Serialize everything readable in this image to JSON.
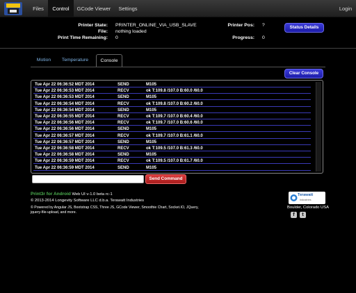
{
  "navbar": {
    "items": [
      {
        "label": "Files"
      },
      {
        "label": "Control",
        "active": true
      },
      {
        "label": "GCode Viewer"
      },
      {
        "label": "Settings"
      }
    ],
    "login": "Login"
  },
  "status": {
    "printer_state_label": "Printer State:",
    "printer_state": "PRINTER_ONLINE_VIA_USB_SLAVE",
    "file_label": "File:",
    "file": "nothing loaded",
    "print_time_label": "Print Time Remaining:",
    "print_time": "0",
    "printer_pos_label": "Printer Pos:",
    "printer_pos": "?",
    "progress_label": "Progress:",
    "progress": "0",
    "details_button": "Status Details"
  },
  "tabs": [
    {
      "label": "Motion"
    },
    {
      "label": "Temperature"
    },
    {
      "label": "Console",
      "active": true
    }
  ],
  "console": {
    "clear_button": "Clear Console",
    "rows": [
      {
        "time": "Tue Apr 22 06:36:52 MDT 2014",
        "dir": "SEND",
        "msg": "M105"
      },
      {
        "time": "Tue Apr 22 06:36:53 MDT 2014",
        "dir": "RECV",
        "msg": "ok T:109.8 /107.0 B:60.0 /60.0"
      },
      {
        "time": "Tue Apr 22 06:36:53 MDT 2014",
        "dir": "SEND",
        "msg": "M105"
      },
      {
        "time": "Tue Apr 22 06:36:54 MDT 2014",
        "dir": "RECV",
        "msg": "ok T:109.8 /107.0 B:60.2 /60.0"
      },
      {
        "time": "Tue Apr 22 06:36:54 MDT 2014",
        "dir": "SEND",
        "msg": "M105"
      },
      {
        "time": "Tue Apr 22 06:36:55 MDT 2014",
        "dir": "RECV",
        "msg": "ok T:109.7 /107.0 B:60.4 /60.0"
      },
      {
        "time": "Tue Apr 22 06:36:56 MDT 2014",
        "dir": "RECV",
        "msg": "ok T:109.7 /107.0 B:60.6 /60.0"
      },
      {
        "time": "Tue Apr 22 06:36:56 MDT 2014",
        "dir": "SEND",
        "msg": "M105"
      },
      {
        "time": "Tue Apr 22 06:36:57 MDT 2014",
        "dir": "RECV",
        "msg": "ok T:109.7 /107.0 B:61.1 /60.0"
      },
      {
        "time": "Tue Apr 22 06:36:57 MDT 2014",
        "dir": "SEND",
        "msg": "M105"
      },
      {
        "time": "Tue Apr 22 06:36:58 MDT 2014",
        "dir": "RECV",
        "msg": "ok T:109.5 /107.0 B:61.3 /60.0"
      },
      {
        "time": "Tue Apr 22 06:36:58 MDT 2014",
        "dir": "SEND",
        "msg": "M105"
      },
      {
        "time": "Tue Apr 22 06:36:59 MDT 2014",
        "dir": "RECV",
        "msg": "ok T:109.5 /107.0 B:61.7 /60.0"
      },
      {
        "time": "Tue Apr 22 06:36:59 MDT 2014",
        "dir": "SEND",
        "msg": "M105"
      }
    ]
  },
  "command": {
    "input_value": "",
    "send_button": "Send Command"
  },
  "footer": {
    "brand": "Print3r for Android",
    "version": "Web UI v-1.0 beta rc-1",
    "copyright": "© 2013-2014 Longevity Software LLC d.b.a. Terawatt Industries",
    "powered_line1": "© Powered by Angular JS, Bootstrap CSS, Three JS, GCode Viewer, Smoothie Chart, Socket.IO, JQuery,",
    "powered_line2": "jquery-file-upload, and more.",
    "terawatt_name": "Terawatt",
    "terawatt_sub": "Industries",
    "location": "Boulder, Colorado  USA",
    "facebook_glyph": "f",
    "twitter_glyph": "t"
  },
  "colors": {
    "primary_button": "#2a2ac8",
    "danger_button": "#c02424",
    "brand_green": "#4caf50",
    "tab_link": "#7fb4e6"
  }
}
